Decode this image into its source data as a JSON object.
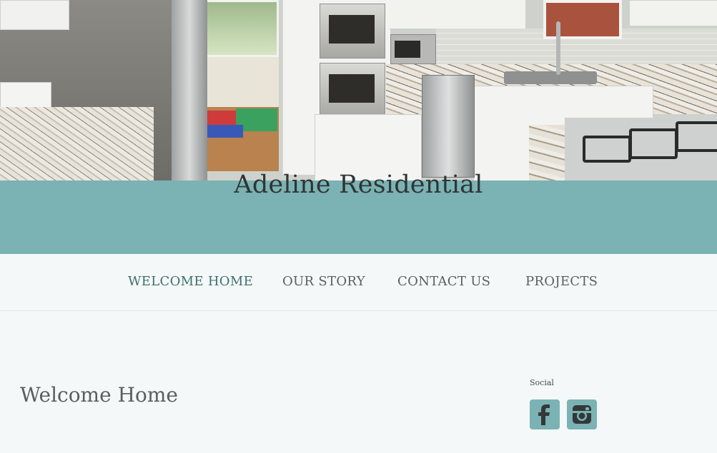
{
  "site": {
    "title": "Adeline Residential"
  },
  "nav": {
    "items": [
      {
        "label": "WELCOME HOME",
        "active": true
      },
      {
        "label": "OUR STORY",
        "active": false
      },
      {
        "label": "CONTACT US",
        "active": false
      },
      {
        "label": "PROJECTS",
        "active": false
      }
    ]
  },
  "main": {
    "heading": "Welcome Home"
  },
  "sidebar": {
    "widget_title": "Social",
    "social_links": [
      {
        "icon": "facebook-icon"
      },
      {
        "icon": "instagram-icon"
      }
    ]
  },
  "colors": {
    "accent": "#7bb2b4",
    "background": "#f4f8f8",
    "title_text": "#2f3535",
    "nav_active": "#3f6e70",
    "nav_text": "#5b5f5f"
  }
}
